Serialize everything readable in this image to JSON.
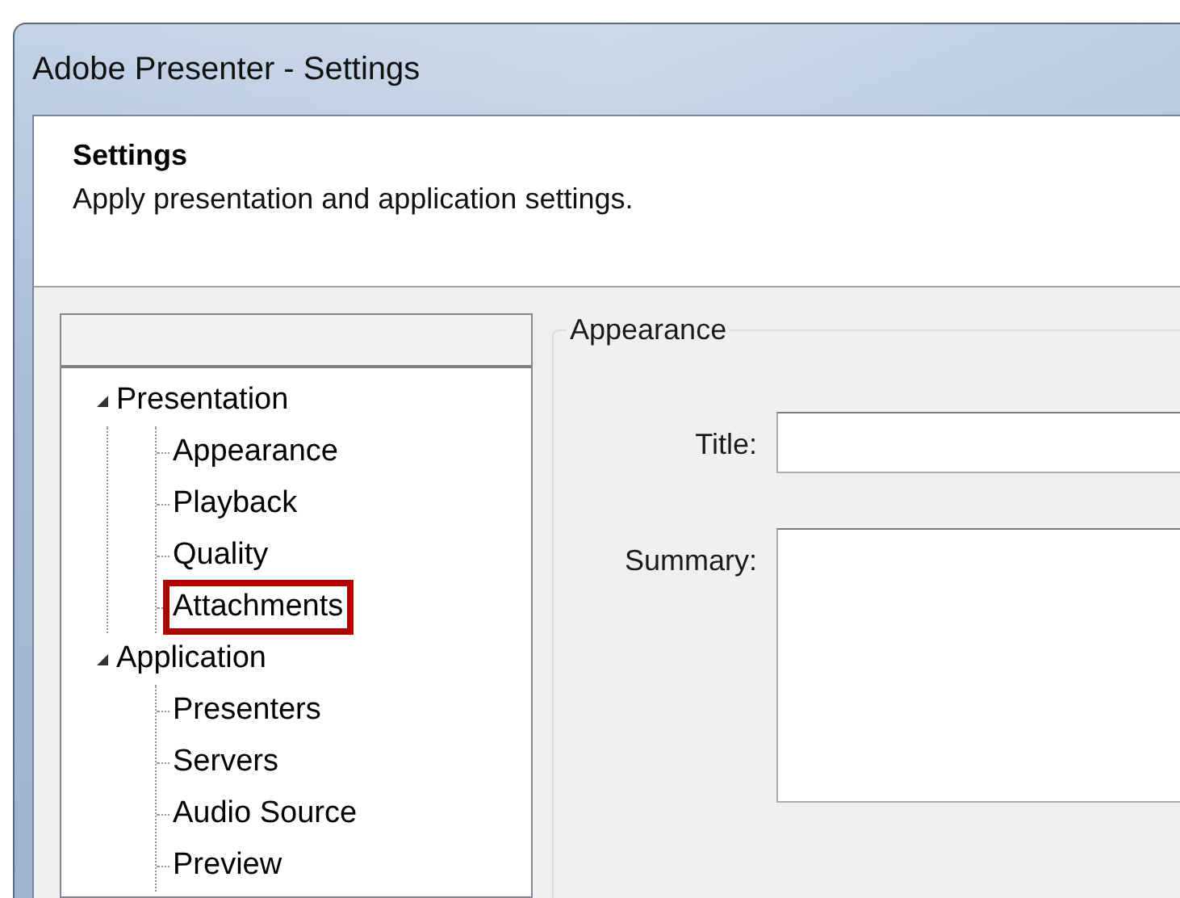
{
  "window": {
    "title": "Adobe Presenter - Settings"
  },
  "header": {
    "title": "Settings",
    "subtitle": "Apply presentation and application settings."
  },
  "tree": {
    "items": [
      {
        "label": "Presentation",
        "expanded": true,
        "children": [
          {
            "label": "Appearance",
            "highlighted": false
          },
          {
            "label": "Playback",
            "highlighted": false
          },
          {
            "label": "Quality",
            "highlighted": false
          },
          {
            "label": "Attachments",
            "highlighted": true
          }
        ]
      },
      {
        "label": "Application",
        "expanded": true,
        "children": [
          {
            "label": "Presenters",
            "highlighted": false
          },
          {
            "label": "Servers",
            "highlighted": false
          },
          {
            "label": "Audio Source",
            "highlighted": false
          },
          {
            "label": "Preview",
            "highlighted": false
          }
        ]
      }
    ]
  },
  "group": {
    "title": "Appearance",
    "fields": [
      {
        "label": "Title:",
        "kind": "line"
      },
      {
        "label": "Summary:",
        "kind": "area"
      }
    ]
  }
}
